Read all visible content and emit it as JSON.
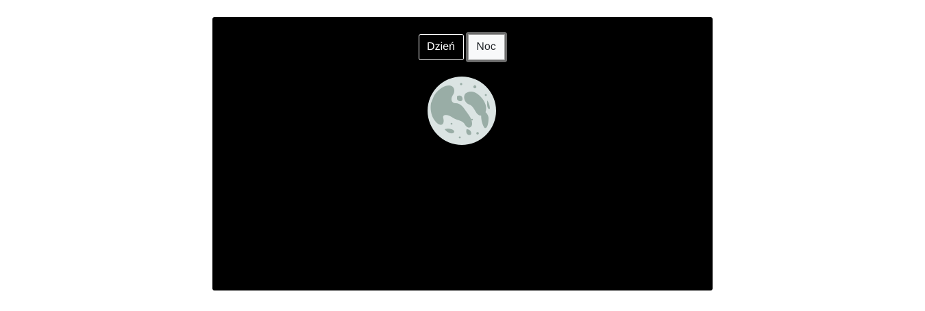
{
  "scene": {
    "mode": "night",
    "background_color": "#000000"
  },
  "toggle": {
    "day_label": "Dzień",
    "night_label": "Noc"
  },
  "moon": {
    "icon": "moon-icon",
    "surface_color": "#dbe4e3",
    "crater_color": "#99ada6"
  }
}
